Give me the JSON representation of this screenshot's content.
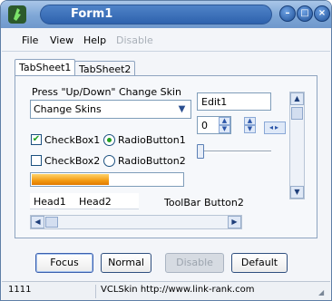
{
  "window": {
    "title": "Form1"
  },
  "caption_buttons": {
    "minimize": "–",
    "maximize": "□",
    "close": "×"
  },
  "menu": [
    {
      "label": "File",
      "disabled": false
    },
    {
      "label": "View",
      "disabled": false
    },
    {
      "label": "Help",
      "disabled": false
    },
    {
      "label": "Disable",
      "disabled": true
    }
  ],
  "tabs": [
    {
      "label": "TabSheet1",
      "active": true
    },
    {
      "label": "TabSheet2",
      "active": false
    }
  ],
  "skin": {
    "prompt": "Press \"Up/Down\" Change Skin",
    "combo_value": "Change Skins"
  },
  "edit1": {
    "value": "Edit1"
  },
  "spin": {
    "value": "0"
  },
  "checkboxes": [
    {
      "label": "CheckBox1",
      "checked": true
    },
    {
      "label": "CheckBox2",
      "checked": false
    }
  ],
  "radios": [
    {
      "label": "RadioButton1",
      "checked": true
    },
    {
      "label": "RadioButton2",
      "checked": false
    }
  ],
  "trackbar": {
    "position": 0
  },
  "progress": {
    "percent": 51
  },
  "header": {
    "sections": [
      "Head1",
      "Head2"
    ]
  },
  "toolbar": {
    "label": "ToolBar",
    "button": "Button2"
  },
  "buttons": [
    {
      "label": "Focus",
      "state": "focused"
    },
    {
      "label": "Normal",
      "state": "normal"
    },
    {
      "label": "Disable",
      "state": "disabled"
    },
    {
      "label": "Default",
      "state": "normal"
    }
  ],
  "status": {
    "panel1": "1111",
    "panel2": "VCLSkin http://www.link-rank.com"
  },
  "colors": {
    "title_bar": "#6f98cc",
    "progress_fill": "#f39a12",
    "check_mark": "#21a121"
  }
}
